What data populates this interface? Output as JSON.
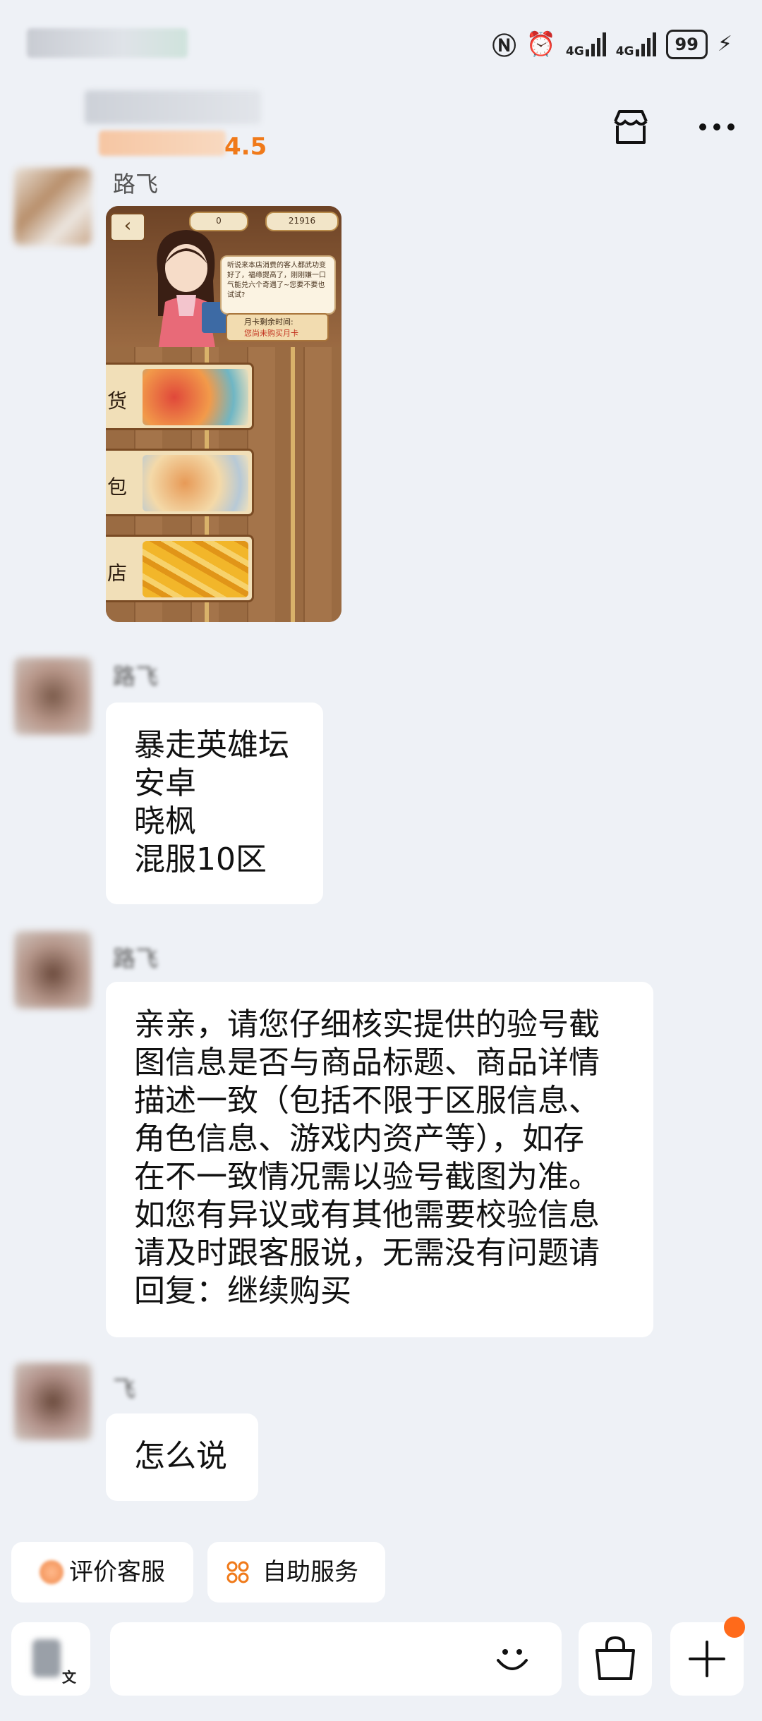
{
  "status_bar": {
    "battery": "99",
    "network_1": "4G",
    "network_2": "4G"
  },
  "header": {
    "rating": "4.5"
  },
  "messages": [
    {
      "sender": "路飞",
      "type": "image",
      "image": {
        "coins": "0",
        "gems": "21916",
        "dialog": "听说来本店消费的客人都武功变好了，福缘提高了，刚刚嫌一口气能兑六个奇遇了~您要不要也试试?",
        "month_card_title": "月卡剩余时间:",
        "month_card_value": "您尚未购买月卡",
        "rows": [
          "货",
          "包",
          "店"
        ]
      }
    },
    {
      "sender": "路飞",
      "type": "text",
      "lines": [
        "暴走英雄坛",
        "安卓",
        "晓枫",
        "混服10区"
      ]
    },
    {
      "sender": "路飞",
      "type": "text",
      "lines": [
        "亲亲，请您仔细核实提供的验号截",
        "图信息是否与商品标题、商品详情",
        "描述一致（包括不限于区服信息、",
        "角色信息、游戏内资产等），如存",
        "在不一致情况需以验号截图为准。",
        "如您有异议或有其他需要校验信息",
        "请及时跟客服说，无需没有问题请",
        "回复：继续购买"
      ]
    },
    {
      "sender": "飞",
      "type": "text",
      "lines": [
        "怎么说"
      ]
    }
  ],
  "quick_actions": {
    "rate_service": "评价客服",
    "self_service": "自助服务"
  },
  "input_bar": {
    "voice_label": "文"
  },
  "colors": {
    "accent": "#f07a1a",
    "background": "#eef1f6",
    "notification_dot": "#ff6a1a"
  }
}
